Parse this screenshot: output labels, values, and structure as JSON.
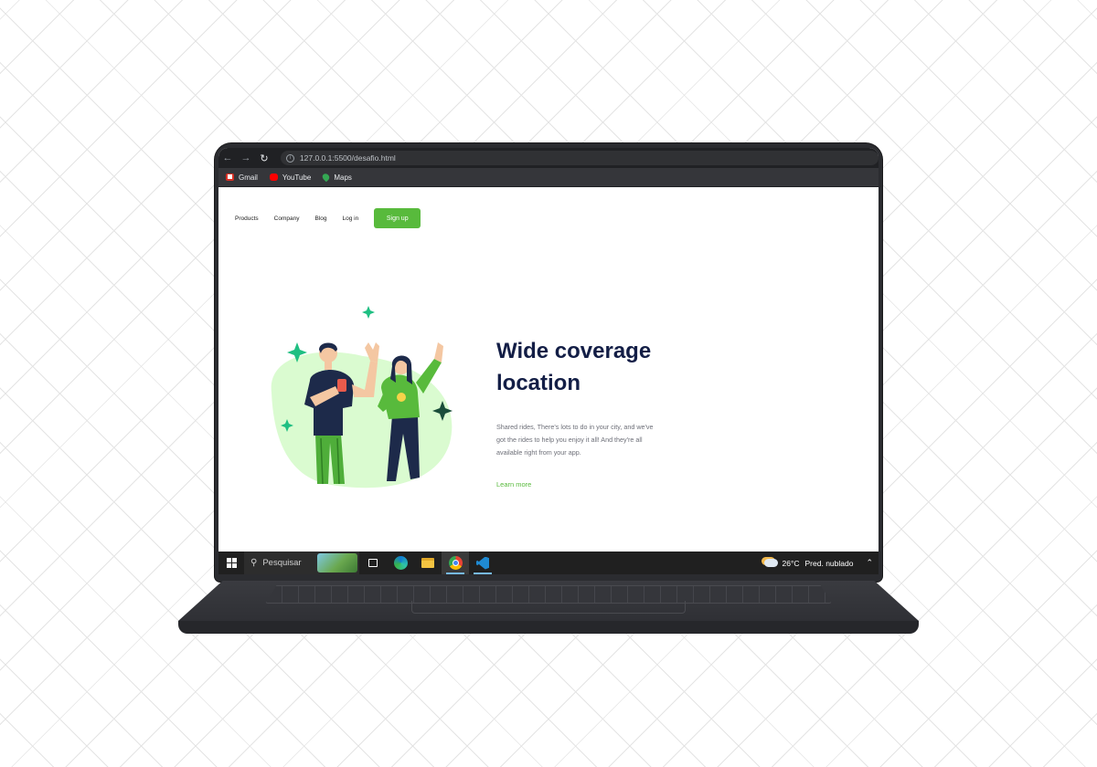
{
  "browser": {
    "url": "127.0.0.1:5500/desafio.html",
    "bookmarks": [
      {
        "label": "Gmail",
        "color": "#d93025"
      },
      {
        "label": "YouTube",
        "color": "#ff0000"
      },
      {
        "label": "Maps",
        "color": "#34a853"
      }
    ]
  },
  "page": {
    "nav": {
      "items": [
        "Products",
        "Company",
        "Blog",
        "Log in"
      ],
      "signup_label": "Sign up"
    },
    "hero": {
      "title_line1": "Wide coverage",
      "title_line2": "location",
      "text_line1": "Shared rides, There's lots to do in your city, and we've",
      "text_line2": "got the rides to help you enjoy it all! And they're all",
      "text_line3": "available right from your app.",
      "link": "Learn more"
    },
    "colors": {
      "accent": "#58ba3c",
      "title": "#131e46",
      "blob": "#dafbd0"
    }
  },
  "taskbar": {
    "search_placeholder": "Pesquisar",
    "apps": [
      "widgets-icon",
      "task-view-icon",
      "edge-icon",
      "file-explorer-icon",
      "chrome-icon",
      "vscode-icon"
    ],
    "weather_temp": "26°C",
    "weather_text": "Pred. nublado"
  }
}
